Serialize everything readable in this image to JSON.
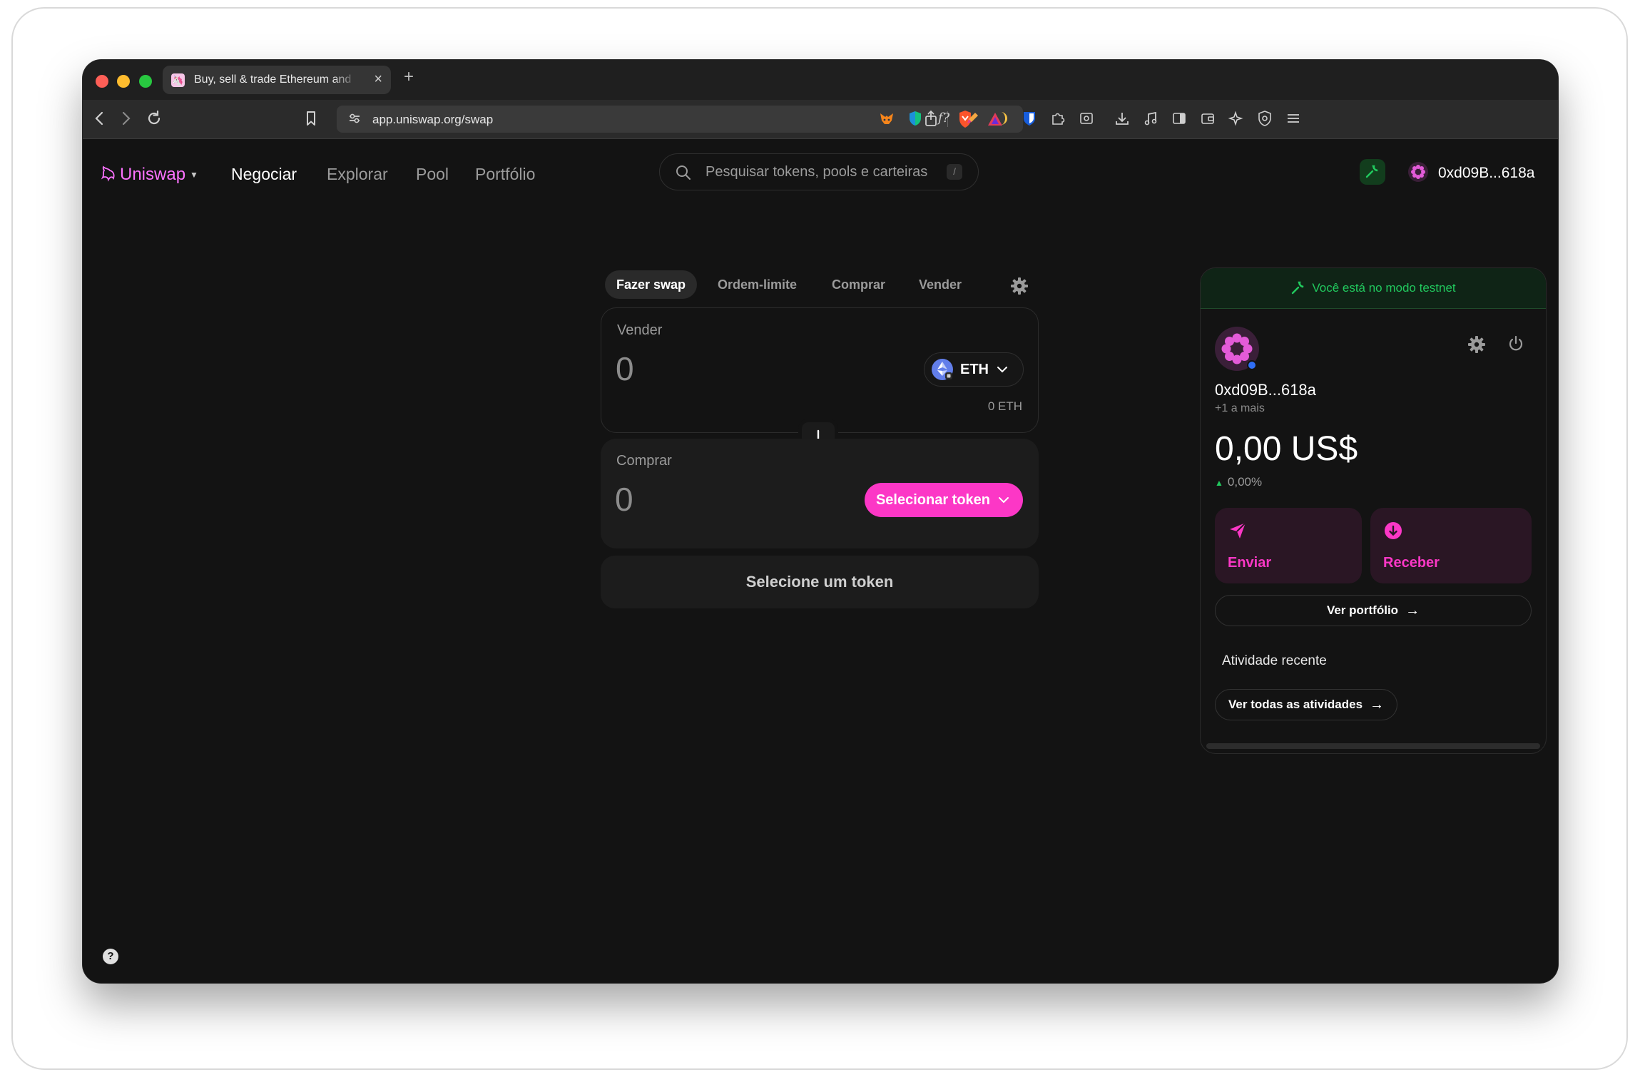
{
  "browser": {
    "tab_title": "Buy, sell & trade Ethereum and",
    "url": "app.uniswap.org/swap",
    "new_tab": "+",
    "close": "×"
  },
  "header": {
    "brand": "Uniswap",
    "nav": [
      "Negociar",
      "Explorar",
      "Pool",
      "Portfólio"
    ],
    "search_placeholder": "Pesquisar tokens, pools e carteiras",
    "search_shortcut": "/",
    "account": "0xd09B...618a"
  },
  "swap": {
    "tabs": [
      "Fazer swap",
      "Ordem-limite",
      "Comprar",
      "Vender"
    ],
    "sell_label": "Vender",
    "sell_amount": "0",
    "sell_token": "ETH",
    "sell_balance": "0 ETH",
    "buy_label": "Comprar",
    "buy_amount": "0",
    "select_token": "Selecionar token",
    "cta": "Selecione um token"
  },
  "drawer": {
    "testnet_banner": "Você está no modo testnet",
    "address": "0xd09B...618a",
    "more": "+1 a mais",
    "balance": "0,00 US$",
    "change": "0,00%",
    "send": "Enviar",
    "receive": "Receber",
    "view_portfolio": "Ver portfólio",
    "recent_activity": "Atividade recente",
    "view_all": "Ver todas as atividades"
  },
  "help": "?",
  "colors": {
    "accent": "#fc37c6",
    "brand": "#fc72ff",
    "testnet": "#21c95e",
    "background": "#131313"
  }
}
